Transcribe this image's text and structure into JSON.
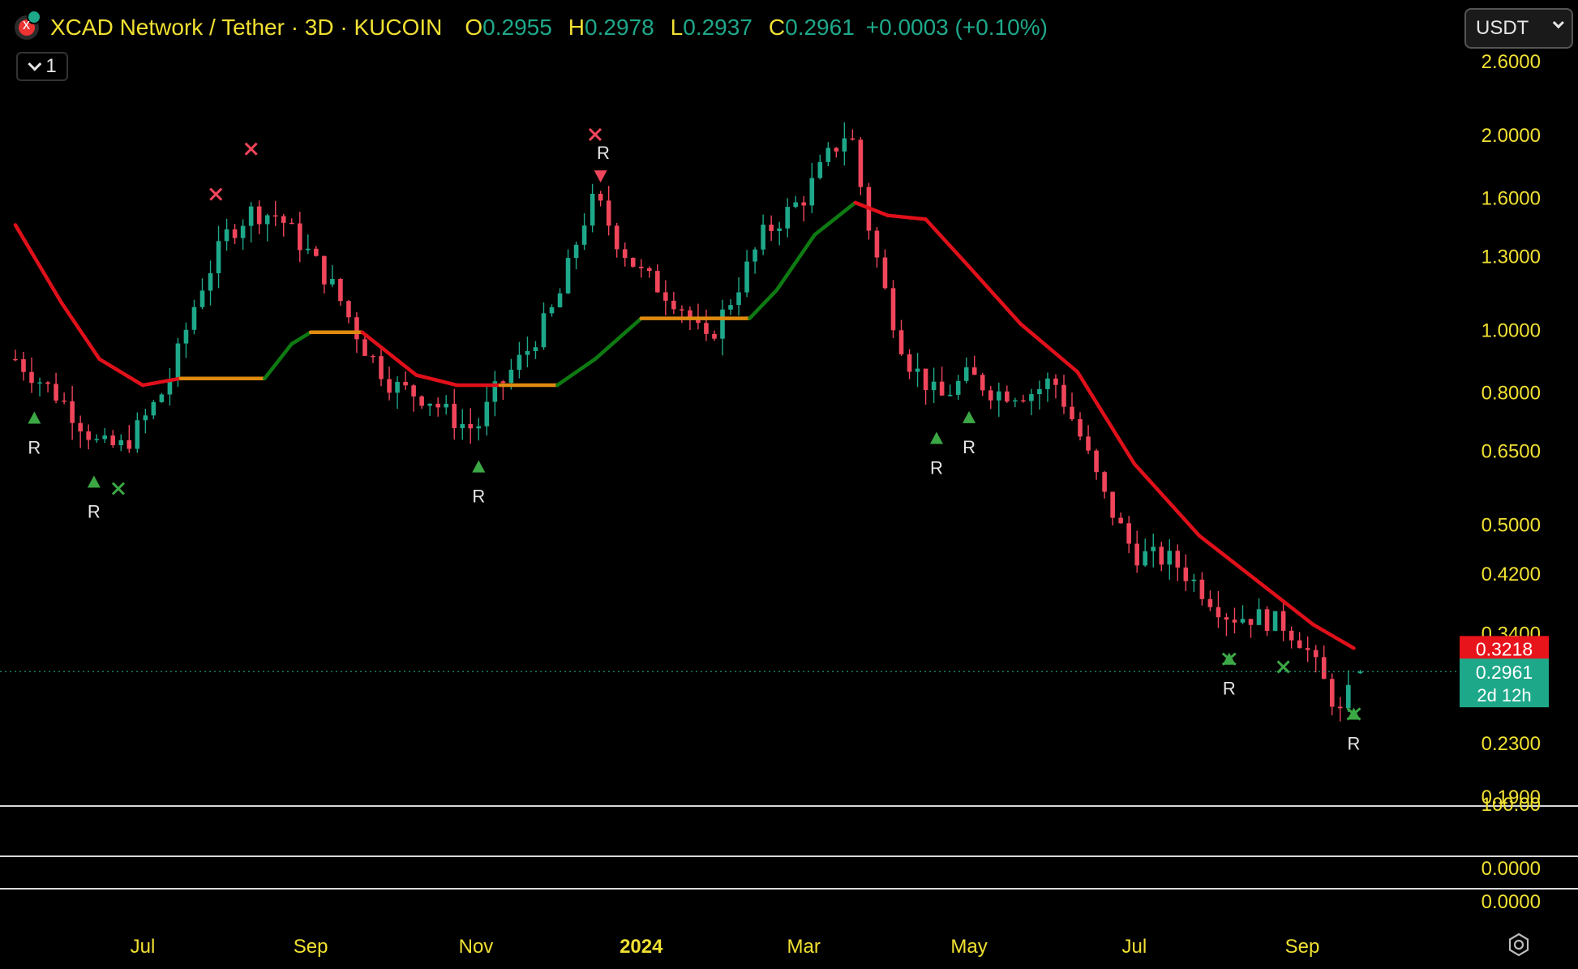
{
  "header": {
    "title": "XCAD Network / Tether · 3D · KUCOIN",
    "o_label": "O",
    "o_value": "0.2955",
    "h_label": "H",
    "h_value": "0.2978",
    "l_label": "L",
    "l_value": "0.2937",
    "c_label": "C",
    "c_value": "0.2961",
    "change": "+0.0003 (+0.10%)",
    "logo_icon": "xcad-token-icon"
  },
  "collapse_button": {
    "label": "1",
    "icon": "chevron-down-icon"
  },
  "currency_select": {
    "value": "USDT",
    "icon": "chevron-down-icon"
  },
  "settings_icon": "gear-icon",
  "colors": {
    "background": "#000000",
    "up": "#1ea88a",
    "down": "#f0455a",
    "ma_line": "#e0101a",
    "trail_green": "#0e7a12",
    "trail_orange": "#e08a10",
    "text": "#f0e033",
    "marker_green": "#3ba845",
    "marker_red": "#f0455a"
  },
  "chart_data": {
    "type": "candlestick",
    "symbol": "XCAD Network / Tether",
    "interval": "3D",
    "exchange": "KUCOIN",
    "y_scale": "log",
    "ylim": [
      0.19,
      2.6
    ],
    "y_ticks": [
      "2.6000",
      "2.0000",
      "1.6000",
      "1.3000",
      "1.0000",
      "0.8000",
      "0.6500",
      "0.5000",
      "0.4200",
      "0.3400",
      "0.2300",
      "0.1900"
    ],
    "x_ticks": [
      "Jul",
      "Sep",
      "Nov",
      "2024",
      "Mar",
      "May",
      "Jul",
      "Sep"
    ],
    "x_tick_dates": [
      "2023-07-01",
      "2023-09-01",
      "2023-11-01",
      "2024-01-01",
      "2024-03-01",
      "2024-05-01",
      "2024-07-01",
      "2024-09-01"
    ],
    "x_range": [
      "2023-05-15",
      "2024-10-15"
    ],
    "price_path": [
      [
        "2023-05-15",
        0.9
      ],
      [
        "2023-06-01",
        0.78
      ],
      [
        "2023-06-15",
        0.66
      ],
      [
        "2023-06-24",
        0.66
      ],
      [
        "2023-07-01",
        0.72
      ],
      [
        "2023-07-10",
        0.82
      ],
      [
        "2023-07-22",
        1.15
      ],
      [
        "2023-08-01",
        1.4
      ],
      [
        "2023-08-10",
        1.52
      ],
      [
        "2023-08-20",
        1.5
      ],
      [
        "2023-09-01",
        1.3
      ],
      [
        "2023-09-10",
        1.15
      ],
      [
        "2023-09-20",
        0.95
      ],
      [
        "2023-10-01",
        0.82
      ],
      [
        "2023-10-15",
        0.78
      ],
      [
        "2023-10-25",
        0.72
      ],
      [
        "2023-11-01",
        0.7
      ],
      [
        "2023-11-08",
        0.8
      ],
      [
        "2023-11-20",
        0.93
      ],
      [
        "2023-12-01",
        1.1
      ],
      [
        "2023-12-10",
        1.45
      ],
      [
        "2023-12-15",
        1.6
      ],
      [
        "2023-12-24",
        1.35
      ],
      [
        "2024-01-01",
        1.22
      ],
      [
        "2024-01-15",
        1.1
      ],
      [
        "2024-01-25",
        0.95
      ],
      [
        "2024-02-05",
        1.15
      ],
      [
        "2024-02-15",
        1.4
      ],
      [
        "2024-03-01",
        1.6
      ],
      [
        "2024-03-10",
        1.85
      ],
      [
        "2024-03-18",
        2.05
      ],
      [
        "2024-03-24",
        1.5
      ],
      [
        "2024-04-01",
        1.1
      ],
      [
        "2024-04-08",
        0.9
      ],
      [
        "2024-04-20",
        0.78
      ],
      [
        "2024-05-01",
        0.85
      ],
      [
        "2024-05-10",
        0.8
      ],
      [
        "2024-05-25",
        0.8
      ],
      [
        "2024-06-01",
        0.84
      ],
      [
        "2024-06-10",
        0.7
      ],
      [
        "2024-06-20",
        0.55
      ],
      [
        "2024-07-01",
        0.45
      ],
      [
        "2024-07-15",
        0.44
      ],
      [
        "2024-07-25",
        0.4
      ],
      [
        "2024-08-05",
        0.36
      ],
      [
        "2024-08-15",
        0.36
      ],
      [
        "2024-08-25",
        0.35
      ],
      [
        "2024-09-01",
        0.33
      ],
      [
        "2024-09-08",
        0.29
      ],
      [
        "2024-09-16",
        0.25
      ],
      [
        "2024-09-20",
        0.2961
      ]
    ],
    "ma_line": [
      [
        "2023-05-15",
        1.45
      ],
      [
        "2023-06-01",
        1.1
      ],
      [
        "2023-06-15",
        0.9
      ],
      [
        "2023-07-01",
        0.82
      ],
      [
        "2023-07-15",
        0.84
      ],
      [
        "2023-08-01",
        0.84
      ],
      [
        "2023-08-15",
        0.84
      ],
      [
        "2023-08-25",
        0.95
      ],
      [
        "2023-09-01",
        0.99
      ],
      [
        "2023-09-20",
        0.99
      ],
      [
        "2023-10-10",
        0.85
      ],
      [
        "2023-10-25",
        0.82
      ],
      [
        "2023-11-10",
        0.82
      ],
      [
        "2023-12-01",
        0.82
      ],
      [
        "2023-12-15",
        0.9
      ],
      [
        "2024-01-01",
        1.04
      ],
      [
        "2024-01-25",
        1.04
      ],
      [
        "2024-02-10",
        1.04
      ],
      [
        "2024-02-20",
        1.15
      ],
      [
        "2024-03-05",
        1.4
      ],
      [
        "2024-03-20",
        1.57
      ],
      [
        "2024-04-01",
        1.5
      ],
      [
        "2024-04-15",
        1.48
      ],
      [
        "2024-05-01",
        1.25
      ],
      [
        "2024-05-20",
        1.02
      ],
      [
        "2024-06-10",
        0.86
      ],
      [
        "2024-07-01",
        0.62
      ],
      [
        "2024-07-25",
        0.48
      ],
      [
        "2024-08-15",
        0.41
      ],
      [
        "2024-09-05",
        0.35
      ],
      [
        "2024-09-20",
        0.3218
      ]
    ],
    "markers": [
      {
        "date": "2023-05-22",
        "type": "triangle-up",
        "label": "R"
      },
      {
        "date": "2023-06-13",
        "type": "triangle-up",
        "label": "R"
      },
      {
        "date": "2023-06-22",
        "type": "cross",
        "label": ""
      },
      {
        "date": "2023-07-28",
        "type": "cross",
        "label": ""
      },
      {
        "date": "2023-08-10",
        "type": "cross",
        "label": ""
      },
      {
        "date": "2023-11-02",
        "type": "triangle-up",
        "label": "R"
      },
      {
        "date": "2023-12-15",
        "type": "cross",
        "label": "R"
      },
      {
        "date": "2023-12-17",
        "type": "triangle-down",
        "label": ""
      },
      {
        "date": "2024-04-19",
        "type": "triangle-up",
        "label": "R"
      },
      {
        "date": "2024-05-01",
        "type": "triangle-up",
        "label": "R"
      },
      {
        "date": "2024-08-05",
        "type": "star",
        "label": "R"
      },
      {
        "date": "2024-08-25",
        "type": "cross",
        "label": ""
      },
      {
        "date": "2024-09-20",
        "type": "star",
        "label": "R"
      }
    ],
    "last_price": "0.2961",
    "ma_value": "0.3218",
    "countdown": "2d 12h",
    "lower_panes": [
      {
        "y_tick": "100.00"
      },
      {
        "y_tick": "0.0000"
      },
      {
        "y_tick": "0.0000"
      }
    ]
  }
}
